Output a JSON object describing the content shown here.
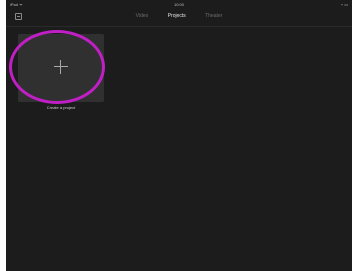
{
  "status_bar": {
    "carrier": "iPad ᯤ",
    "time": "10:00",
    "battery": "⌁ ▭"
  },
  "nav": {
    "tabs": [
      {
        "label": "Video",
        "active": false
      },
      {
        "label": "Projects",
        "active": true
      },
      {
        "label": "Theater",
        "active": false
      }
    ]
  },
  "main": {
    "create_label": "Create a project"
  },
  "colors": {
    "background": "#1c1c1c",
    "tile": "#303030",
    "highlight": "#c11fc6"
  },
  "icons": {
    "settings": "settings-icon",
    "plus": "plus-icon"
  }
}
